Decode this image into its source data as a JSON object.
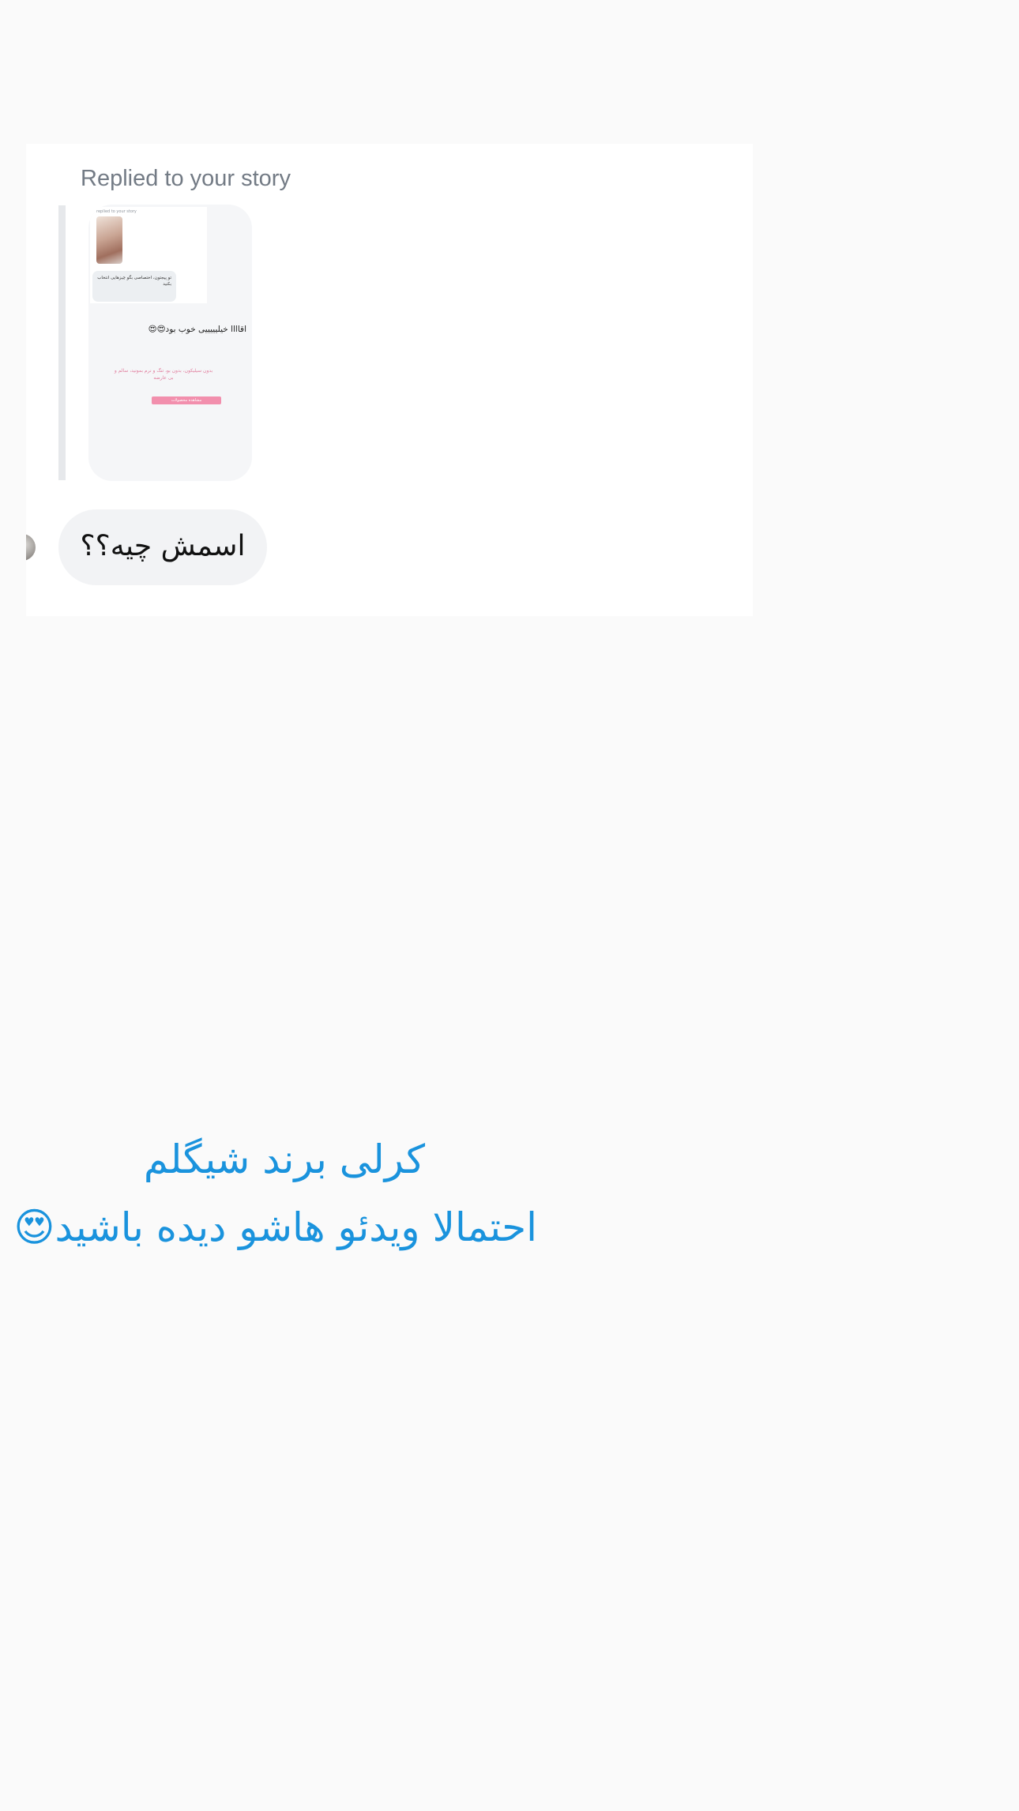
{
  "story_reply": {
    "label": "Replied to your story",
    "preview": {
      "top_line": "replied to your story",
      "bubble_text": "تو پیجتون، اختصاصی بگو چیزهایی انتخاب بکنید",
      "message": "اقاااا خیلیییییی خوب بود😍😍",
      "pink_text": "بدون سیلیکون، بدون بو، تنگ و نرم بمونید، سالم و بی عارضه",
      "pink_bar": "مشاهده محصولات"
    },
    "message": "اسمش چیه؟؟"
  },
  "caption": {
    "line1": "کرلی برند شیگلم",
    "line2": "احتمالا ویدئو هاشو دیده باشید😍"
  }
}
